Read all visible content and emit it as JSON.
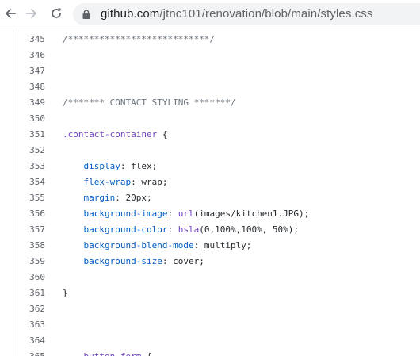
{
  "browser": {
    "url_host": "github.com",
    "url_path": "/jtnc101/renovation/blob/main/styles.css"
  },
  "code": {
    "lines": [
      {
        "num": "345",
        "tokens": [
          {
            "t": "/***************************/",
            "c": "comment"
          }
        ]
      },
      {
        "num": "346",
        "tokens": []
      },
      {
        "num": "347",
        "tokens": []
      },
      {
        "num": "348",
        "tokens": []
      },
      {
        "num": "349",
        "tokens": [
          {
            "t": "/******* CONTACT STYLING *******/",
            "c": "comment"
          }
        ]
      },
      {
        "num": "350",
        "tokens": []
      },
      {
        "num": "351",
        "tokens": [
          {
            "t": ".contact-container",
            "c": "selector"
          },
          {
            "t": " {",
            "c": "plain"
          }
        ]
      },
      {
        "num": "352",
        "tokens": []
      },
      {
        "num": "353",
        "tokens": [
          {
            "t": "    ",
            "c": "plain"
          },
          {
            "t": "display",
            "c": "prop"
          },
          {
            "t": ": flex;",
            "c": "plain"
          }
        ]
      },
      {
        "num": "354",
        "tokens": [
          {
            "t": "    ",
            "c": "plain"
          },
          {
            "t": "flex-wrap",
            "c": "prop"
          },
          {
            "t": ": wrap;",
            "c": "plain"
          }
        ]
      },
      {
        "num": "355",
        "tokens": [
          {
            "t": "    ",
            "c": "plain"
          },
          {
            "t": "margin",
            "c": "prop"
          },
          {
            "t": ": 20px;",
            "c": "plain"
          }
        ]
      },
      {
        "num": "356",
        "tokens": [
          {
            "t": "    ",
            "c": "plain"
          },
          {
            "t": "background-image",
            "c": "prop"
          },
          {
            "t": ": ",
            "c": "plain"
          },
          {
            "t": "url",
            "c": "func"
          },
          {
            "t": "(images/kitchen1.JPG);",
            "c": "plain"
          }
        ]
      },
      {
        "num": "357",
        "tokens": [
          {
            "t": "    ",
            "c": "plain"
          },
          {
            "t": "background-color",
            "c": "prop"
          },
          {
            "t": ": ",
            "c": "plain"
          },
          {
            "t": "hsla",
            "c": "func"
          },
          {
            "t": "(0,100%,100%, 50%);",
            "c": "plain"
          }
        ]
      },
      {
        "num": "358",
        "tokens": [
          {
            "t": "    ",
            "c": "plain"
          },
          {
            "t": "background-blend-mode",
            "c": "prop"
          },
          {
            "t": ": multiply;",
            "c": "plain"
          }
        ]
      },
      {
        "num": "359",
        "tokens": [
          {
            "t": "    ",
            "c": "plain"
          },
          {
            "t": "background-size",
            "c": "prop"
          },
          {
            "t": ": cover;",
            "c": "plain"
          }
        ]
      },
      {
        "num": "360",
        "tokens": []
      },
      {
        "num": "361",
        "tokens": [
          {
            "t": "}",
            "c": "plain"
          }
        ]
      },
      {
        "num": "362",
        "tokens": []
      },
      {
        "num": "363",
        "tokens": []
      },
      {
        "num": "364",
        "tokens": []
      },
      {
        "num": "365",
        "tokens": [
          {
            "t": "    ",
            "c": "plain"
          },
          {
            "t": "button",
            "c": "selector"
          },
          {
            "t": " ",
            "c": "plain"
          },
          {
            "t": "form",
            "c": "selector"
          },
          {
            "t": " {",
            "c": "plain"
          }
        ]
      }
    ]
  },
  "colors": {
    "comment": "#6a737d",
    "selector": "#6f42c1",
    "property": "#005cc5",
    "text": "#24292e",
    "line_number": "#5c6067"
  },
  "icons": [
    "back-arrow-icon",
    "forward-arrow-icon",
    "reload-icon",
    "lock-icon"
  ]
}
